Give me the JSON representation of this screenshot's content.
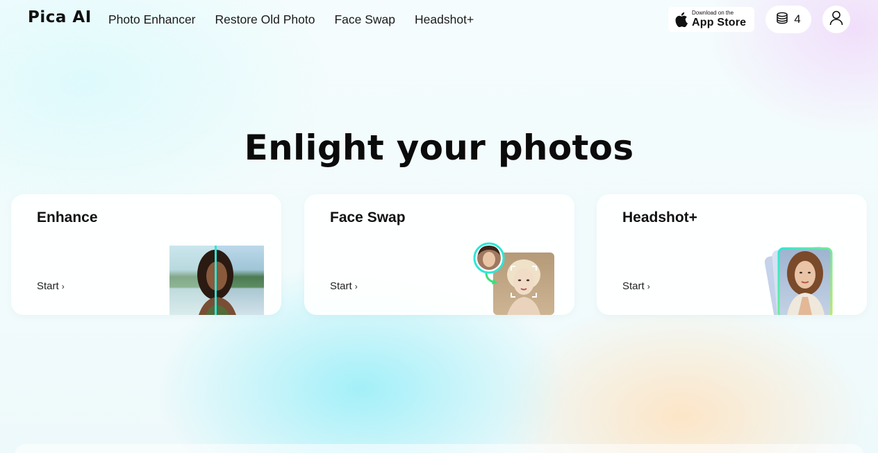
{
  "header": {
    "logo": "Pica AI",
    "nav": [
      "Photo Enhancer",
      "Restore Old Photo",
      "Face Swap",
      "Headshot+"
    ],
    "appstore_small": "Download on the",
    "appstore_big": "App Store",
    "credits": "4"
  },
  "hero": {
    "title": "Enlight your photos"
  },
  "cards": [
    {
      "title": "Enhance",
      "start": "Start"
    },
    {
      "title": "Face Swap",
      "start": "Start"
    },
    {
      "title": "Headshot+",
      "start": "Start"
    }
  ],
  "icons": {
    "apple": "apple-icon",
    "credits": "coin-stack-icon",
    "user": "user-icon",
    "chevron": "chevron-right-icon"
  },
  "colors": {
    "text": "#111111",
    "card_bg": "#ffffff",
    "accent_teal": "#2ee6d6",
    "accent_green": "#39e07a"
  }
}
